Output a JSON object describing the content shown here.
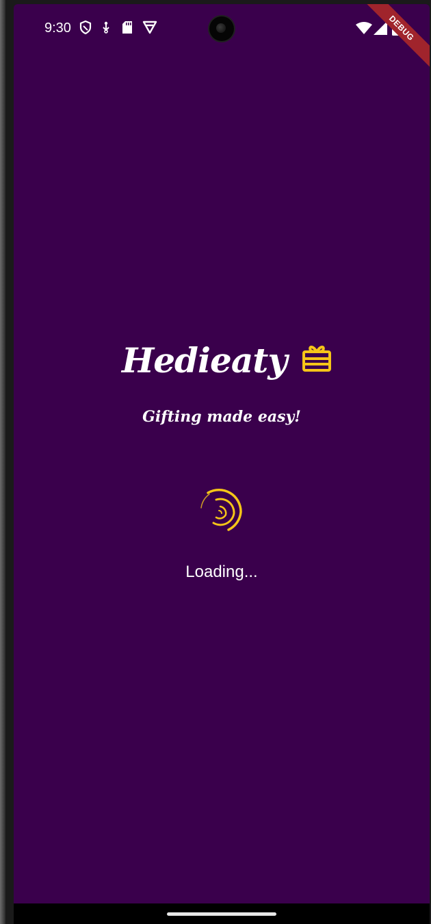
{
  "status_bar": {
    "time": "9:30",
    "left_icons": [
      "shield-icon",
      "usb-debug-icon",
      "sd-card-icon",
      "vpn-icon"
    ],
    "right_icons": [
      "wifi-icon",
      "cell-signal-icon",
      "battery-icon"
    ]
  },
  "debug_banner": {
    "label": "DEBUG"
  },
  "splash": {
    "app_title": "Hedieaty",
    "logo_icon": "gift-box-icon",
    "tagline": "Gifting made easy!",
    "loading_label": "Loading..."
  },
  "colors": {
    "background": "#3a004c",
    "accent": "#f5c518",
    "text": "#ffffff",
    "debug_banner": "#a0242c"
  }
}
